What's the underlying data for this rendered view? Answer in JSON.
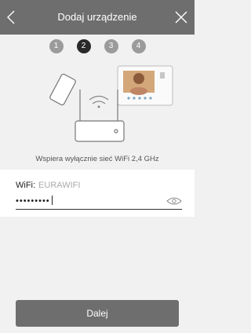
{
  "header": {
    "title": "Dodaj urządzenie",
    "back_icon": "back-icon",
    "close_icon": "close-icon"
  },
  "steps": [
    "1",
    "2",
    "3",
    "4"
  ],
  "active_step": "2",
  "caption": "Wspiera wyłącznie sieć WiFi 2,4 GHz",
  "form": {
    "wifi_label": "WiFi:",
    "wifi_value": "EURAWIFI",
    "password_value": "•••••••••"
  },
  "next_button": "Dalej",
  "colors": {
    "header": "#6e6e6e",
    "active_step": "#2a2a2a",
    "inactive_step": "#9b9b9b"
  }
}
